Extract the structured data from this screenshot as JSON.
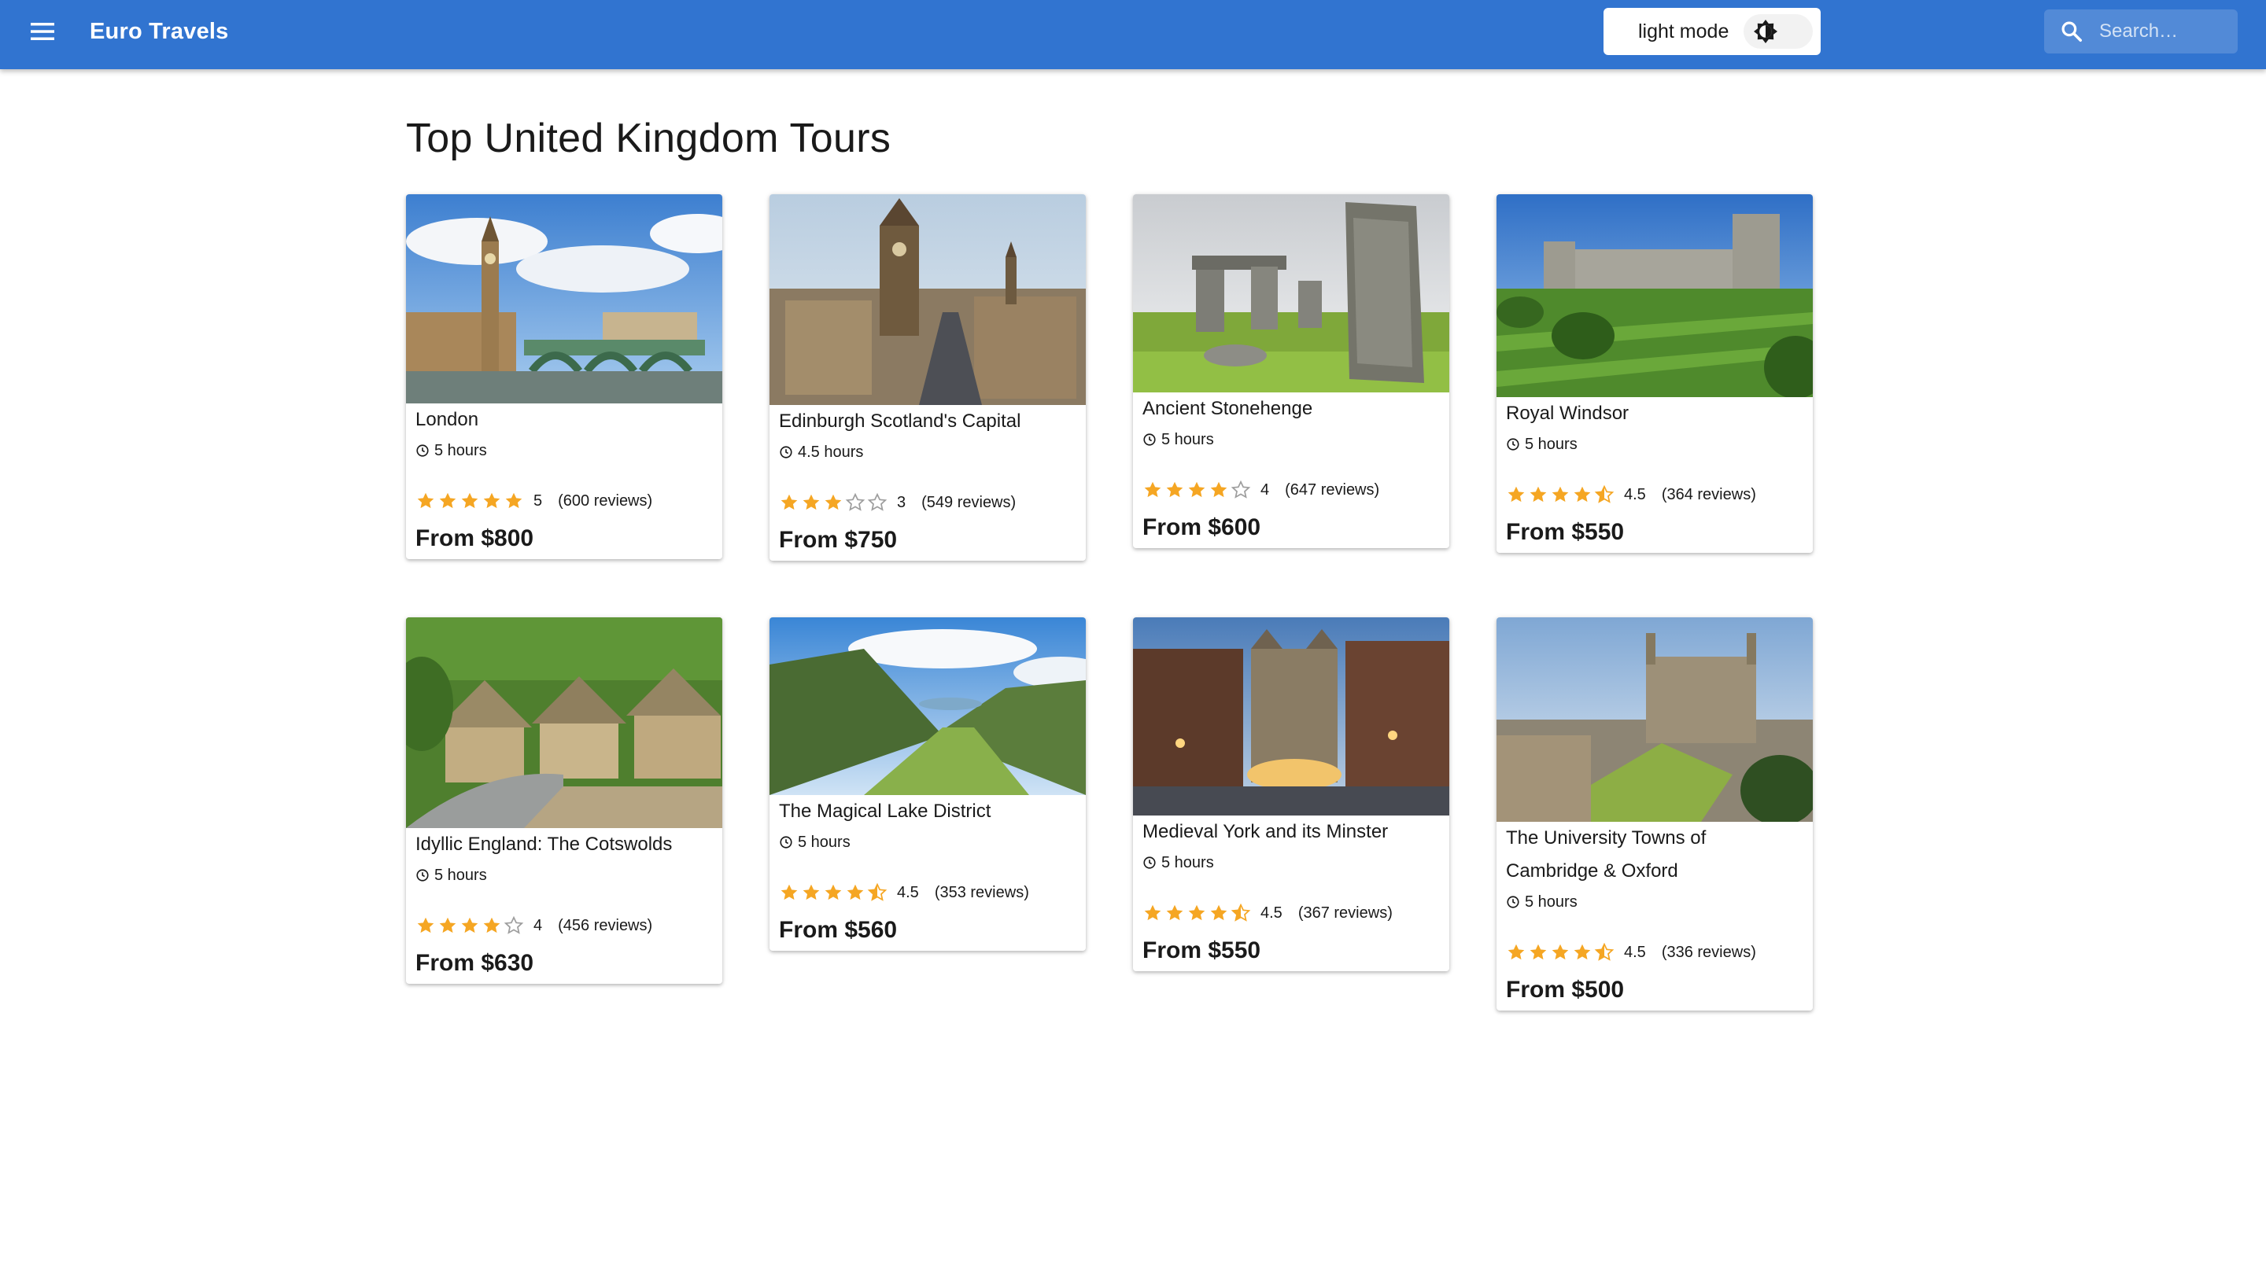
{
  "app": {
    "title": "Euro Travels",
    "menu_icon": "menu-icon"
  },
  "mode_toggle": {
    "label": "light mode",
    "icon": "brightness-icon"
  },
  "search": {
    "placeholder": "Search…",
    "icon": "search-icon"
  },
  "colors": {
    "appbar": "#3174d0",
    "star": "#f5a623",
    "star_empty": "#9e9e9e"
  },
  "page_title": "Top United Kingdom Tours",
  "tours": [
    {
      "name": "London",
      "duration": "5 hours",
      "rating": 5,
      "rating_label": "5",
      "reviews": "(600 reviews)",
      "price": "From $800"
    },
    {
      "name": "Edinburgh Scotland's Capital",
      "duration": "4.5 hours",
      "rating": 3,
      "rating_label": "3",
      "reviews": "(549 reviews)",
      "price": "From $750"
    },
    {
      "name": "Ancient Stonehenge",
      "duration": "5 hours",
      "rating": 4,
      "rating_label": "4",
      "reviews": "(647 reviews)",
      "price": "From $600"
    },
    {
      "name": "Royal Windsor",
      "duration": "5 hours",
      "rating": 4.5,
      "rating_label": "4.5",
      "reviews": "(364 reviews)",
      "price": "From $550"
    },
    {
      "name": "Idyllic England: The Cotswolds",
      "duration": "5 hours",
      "rating": 4,
      "rating_label": "4",
      "reviews": "(456 reviews)",
      "price": "From $630"
    },
    {
      "name": "The Magical Lake District",
      "duration": "5 hours",
      "rating": 4.5,
      "rating_label": "4.5",
      "reviews": "(353 reviews)",
      "price": "From $560"
    },
    {
      "name": "Medieval York and its Minster",
      "duration": "5 hours",
      "rating": 4.5,
      "rating_label": "4.5",
      "reviews": "(367 reviews)",
      "price": "From $550"
    },
    {
      "name": "The University Towns of Cambridge & Oxford",
      "duration": "5 hours",
      "rating": 4.5,
      "rating_label": "4.5",
      "reviews": "(336 reviews)",
      "price": "From $500"
    }
  ]
}
